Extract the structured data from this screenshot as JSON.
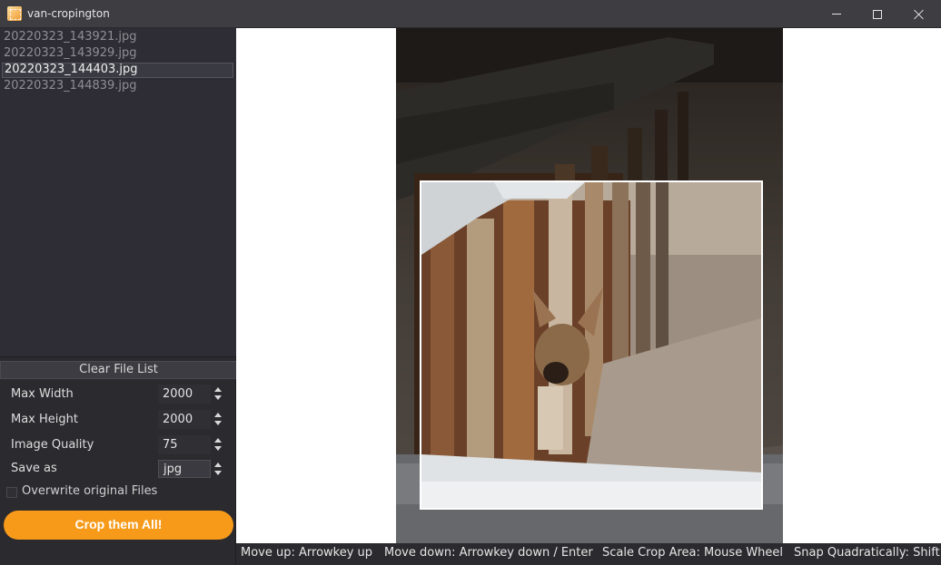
{
  "window": {
    "title": "van-cropington",
    "icon": "app-crop-icon"
  },
  "file_list": [
    {
      "name": "20220323_143921.jpg",
      "selected": false
    },
    {
      "name": "20220323_143929.jpg",
      "selected": false
    },
    {
      "name": "20220323_144403.jpg",
      "selected": true
    },
    {
      "name": "20220323_144839.jpg",
      "selected": false
    }
  ],
  "controls": {
    "clear_label": "Clear File List",
    "max_width_label": "Max Width",
    "max_width_value": "2000",
    "max_height_label": "Max Height",
    "max_height_value": "2000",
    "quality_label": "Image Quality",
    "quality_value": "75",
    "save_as_label": "Save as",
    "save_as_value": "jpg",
    "overwrite_label": "Overwrite original Files",
    "crop_label": "Crop them All!"
  },
  "status_hints": [
    "Move up: Arrowkey up",
    "Move down: Arrowkey down / Enter",
    "Scale Crop Area: Mouse Wheel",
    "Snap Quadratically: Shift"
  ],
  "colors": {
    "accent": "#f79a1a",
    "background": "#2b2b2f",
    "titlebar": "#3d3d42"
  }
}
